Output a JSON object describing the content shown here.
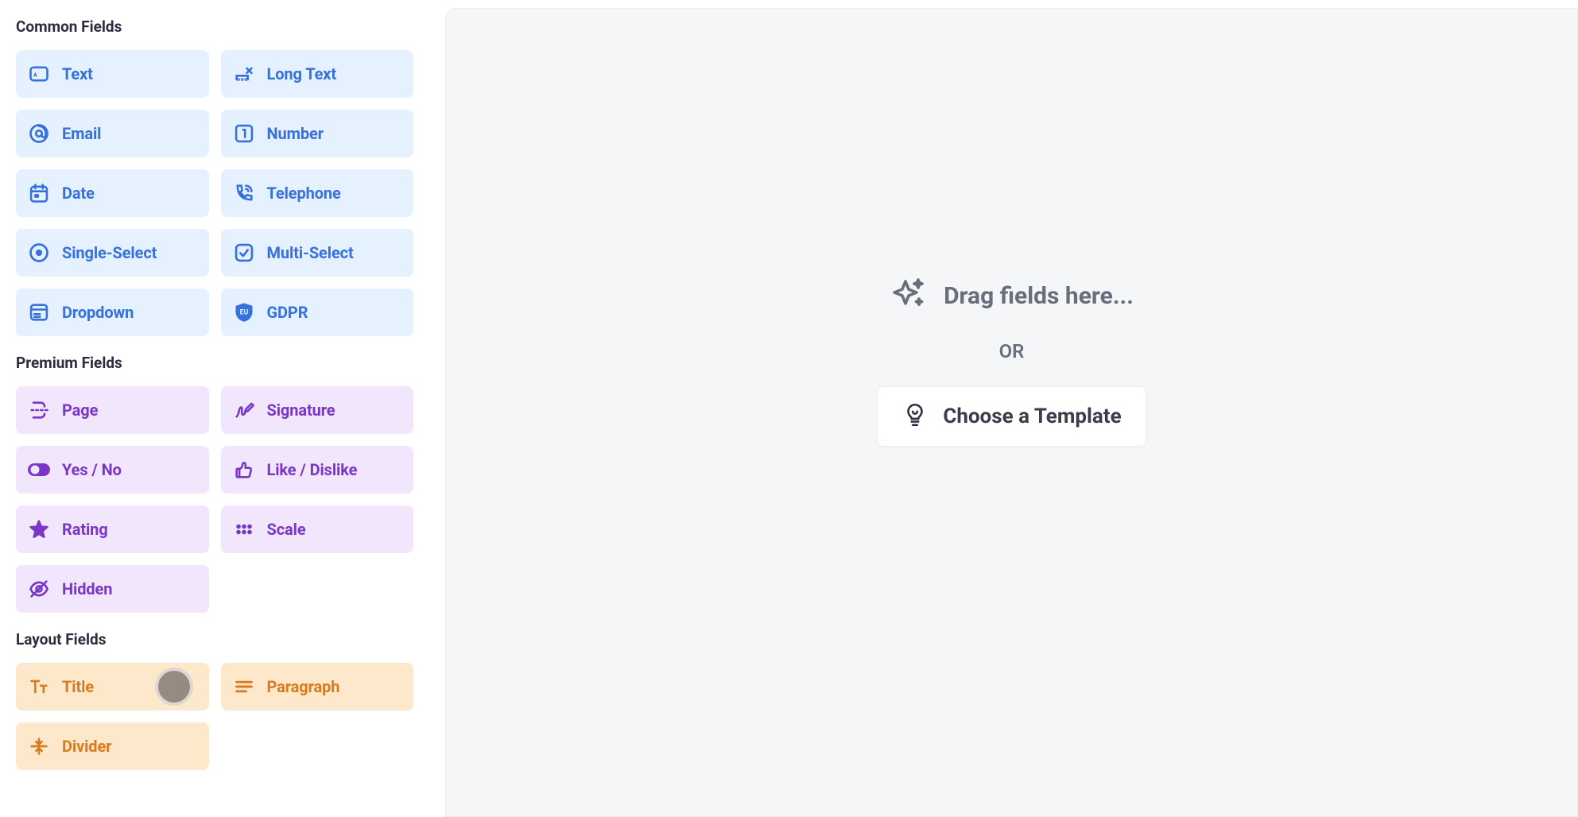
{
  "sidebar": {
    "sections": {
      "common": {
        "title": "Common Fields",
        "items": {
          "text": "Text",
          "long_text": "Long Text",
          "email": "Email",
          "number": "Number",
          "date": "Date",
          "telephone": "Telephone",
          "single_select": "Single-Select",
          "multi_select": "Multi-Select",
          "dropdown": "Dropdown",
          "gdpr": "GDPR"
        }
      },
      "premium": {
        "title": "Premium Fields",
        "items": {
          "page": "Page",
          "signature": "Signature",
          "yes_no": "Yes / No",
          "like_dislike": "Like / Dislike",
          "rating": "Rating",
          "scale": "Scale",
          "hidden": "Hidden"
        }
      },
      "layout": {
        "title": "Layout Fields",
        "items": {
          "title": "Title",
          "paragraph": "Paragraph",
          "divider": "Divider"
        }
      }
    }
  },
  "canvas": {
    "drag_hint": "Drag fields here...",
    "or_label": "OR",
    "template_button": "Choose a Template"
  }
}
